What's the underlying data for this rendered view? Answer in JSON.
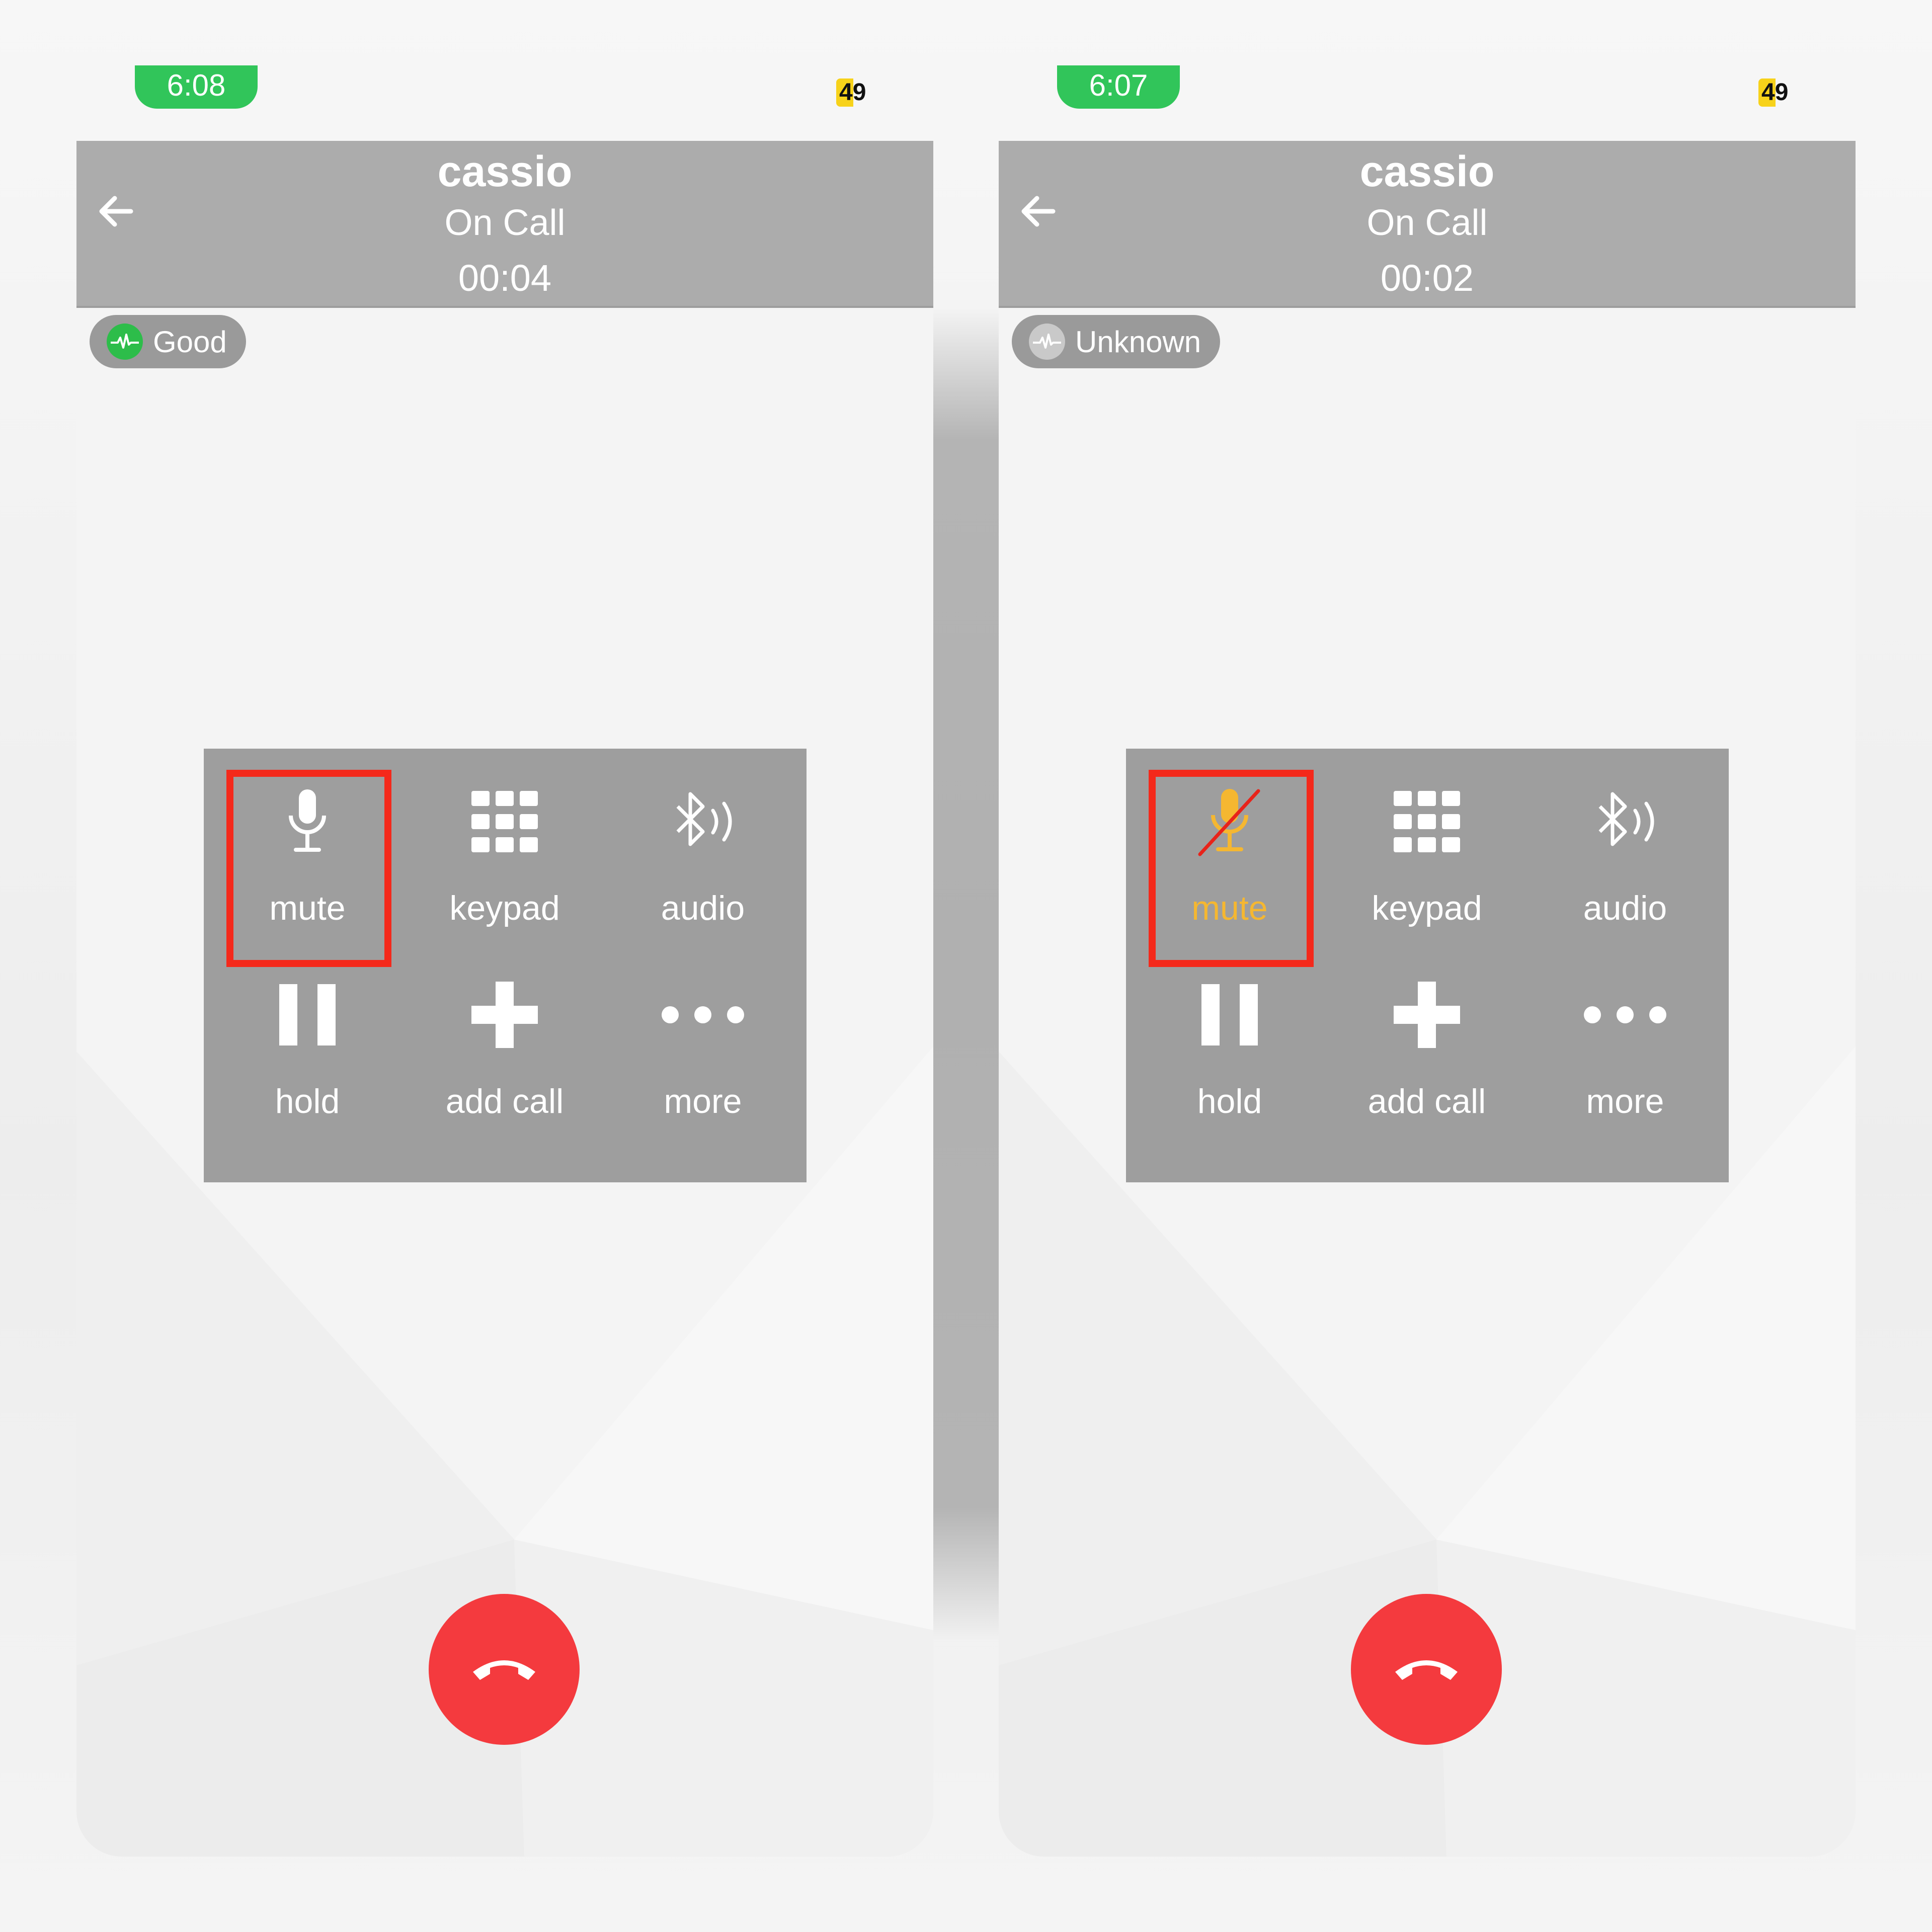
{
  "colors": {
    "status_green": "#31c55a",
    "header_gray": "#acacac",
    "controls_gray": "#9e9e9e",
    "highlight_red": "#f4291b",
    "muted_accent": "#f5b731",
    "end_call_red": "#f43a3e",
    "quality_good": "#2dbd4a"
  },
  "panels": [
    {
      "status": {
        "time": "6:08",
        "battery": "49"
      },
      "header": {
        "back_icon": "arrow-left-icon",
        "name": "cassio",
        "state": "On Call",
        "timer": "00:04"
      },
      "quality": {
        "icon": "waveform-icon",
        "label": "Good",
        "level": "good"
      },
      "controls": [
        {
          "label": "mute",
          "icon": "microphone-icon",
          "active": false,
          "highlighted": true
        },
        {
          "label": "keypad",
          "icon": "keypad-icon"
        },
        {
          "label": "audio",
          "icon": "bluetooth-audio-icon"
        },
        {
          "label": "hold",
          "icon": "pause-icon"
        },
        {
          "label": "add call",
          "icon": "plus-icon"
        },
        {
          "label": "more",
          "icon": "more-dots-icon"
        }
      ],
      "end_call_icon": "hang-up-icon"
    },
    {
      "status": {
        "time": "6:07",
        "battery": "49"
      },
      "header": {
        "back_icon": "arrow-left-icon",
        "name": "cassio",
        "state": "On Call",
        "timer": "00:02"
      },
      "quality": {
        "icon": "waveform-icon",
        "label": "Unknown",
        "level": "unknown"
      },
      "controls": [
        {
          "label": "mute",
          "icon": "microphone-muted-icon",
          "active": true,
          "highlighted": true
        },
        {
          "label": "keypad",
          "icon": "keypad-icon"
        },
        {
          "label": "audio",
          "icon": "bluetooth-audio-icon"
        },
        {
          "label": "hold",
          "icon": "pause-icon"
        },
        {
          "label": "add call",
          "icon": "plus-icon"
        },
        {
          "label": "more",
          "icon": "more-dots-icon"
        }
      ],
      "end_call_icon": "hang-up-icon"
    }
  ]
}
